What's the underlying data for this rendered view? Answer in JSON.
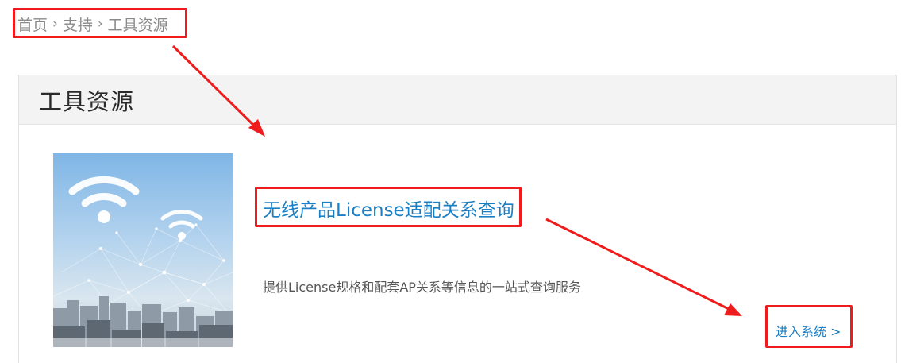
{
  "breadcrumb": {
    "home": "首页",
    "support": "支持",
    "current": "工具资源",
    "separator": "›"
  },
  "panel": {
    "title": "工具资源"
  },
  "product": {
    "title": "无线产品License适配关系查询",
    "description": "提供License规格和配套AP关系等信息的一站式查询服务",
    "enter_link": "进入系统 >",
    "image_icon": "wifi-city-image"
  },
  "annotations": {
    "color": "#ee1c1c"
  },
  "colors": {
    "link": "#1a7fc4",
    "breadcrumb": "#8a8a8a",
    "header_bg": "#f3f3f3"
  }
}
